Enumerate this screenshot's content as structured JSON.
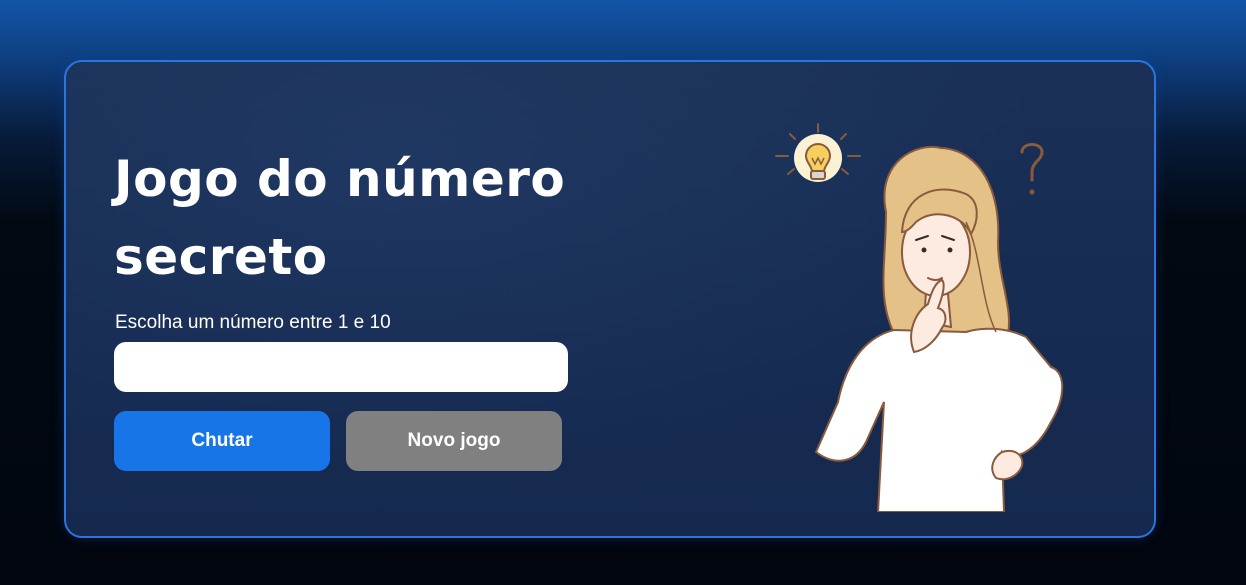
{
  "game": {
    "title": "Jogo do número secreto",
    "instruction": "Escolha um número entre 1 e 10",
    "input_value": "",
    "input_placeholder": ""
  },
  "buttons": {
    "guess_label": "Chutar",
    "new_game_label": "Novo jogo"
  },
  "colors": {
    "accent": "#1875e8",
    "secondary_button": "#808080",
    "card_border": "#2a76de"
  },
  "illustration": {
    "icon": "thinking-woman-with-lightbulb-and-question-mark"
  }
}
